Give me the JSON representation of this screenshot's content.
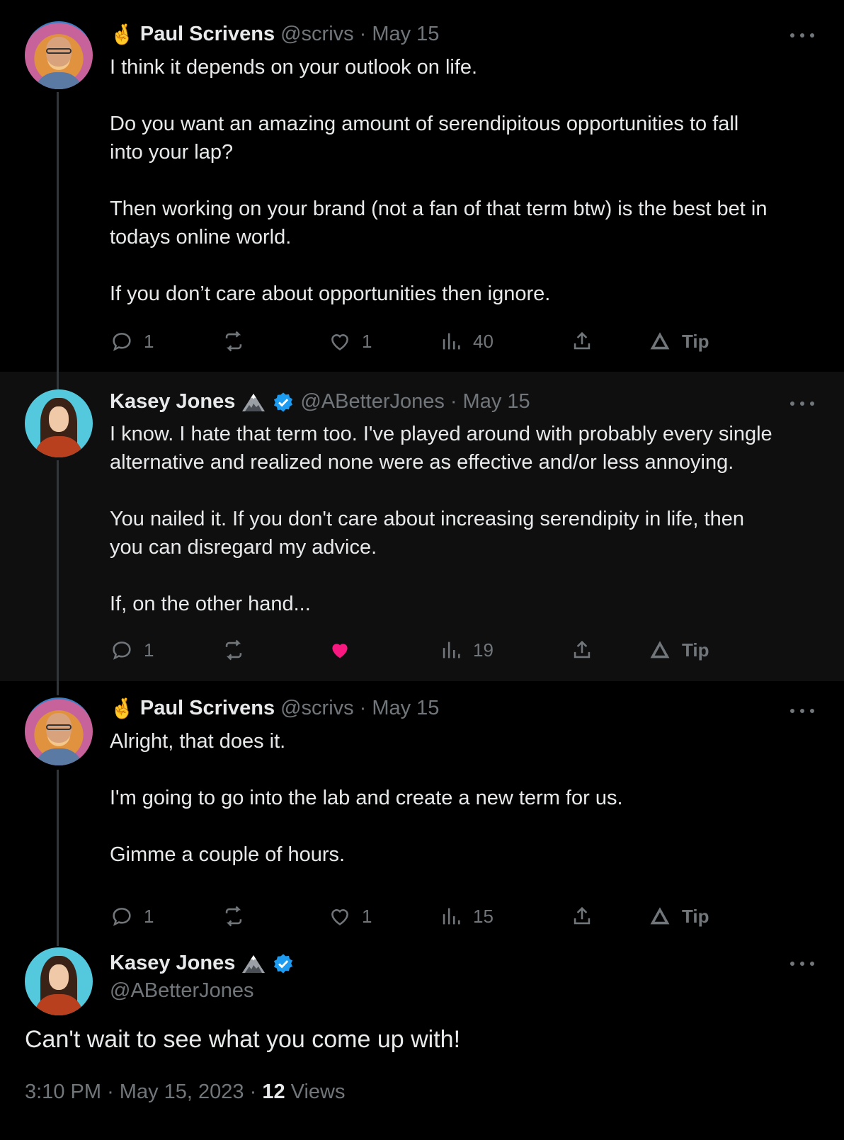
{
  "tweets": [
    {
      "author_emoji": "🤞",
      "author_name": "Paul Scrivens",
      "handle": "@scrivs",
      "separator": "·",
      "date": "May 15",
      "text": "I think it depends on your outlook on life.\n\nDo you want an amazing amount of serendipitous opportunities to fall\ninto your lap?\n\nThen working on your brand (not a fan of that term btw) is the best bet in\ntodays online world.\n\nIf you don’t care about opportunities then ignore.",
      "replies": "1",
      "likes": "1",
      "liked": false,
      "views": "40",
      "tip_label": "Tip"
    },
    {
      "author_name": "Kasey Jones",
      "handle": "@ABetterJones",
      "separator": "·",
      "date": "May 15",
      "text": "I know. I hate that term too. I've played around with probably every single\nalternative and realized none were as effective and/or less annoying.\n\nYou nailed it. If you don't care about increasing serendipity in life, then\nyou can disregard my advice.\n\nIf, on the other hand...",
      "replies": "1",
      "likes": "",
      "liked": true,
      "views": "19",
      "tip_label": "Tip"
    },
    {
      "author_emoji": "🤞",
      "author_name": "Paul Scrivens",
      "handle": "@scrivs",
      "separator": "·",
      "date": "May 15",
      "text": "Alright, that does it.\n\nI'm going to go into the lab and create a new term for us.\n\nGimme a couple of hours.",
      "replies": "1",
      "likes": "1",
      "liked": false,
      "views": "15",
      "tip_label": "Tip"
    }
  ],
  "focused": {
    "author_name": "Kasey Jones",
    "handle": "@ABetterJones",
    "text": "Can't wait to see what you come up with!",
    "time": "3:10 PM",
    "separator": "·",
    "date": "May 15, 2023",
    "views_count": "12",
    "views_label": "Views"
  },
  "colors": {
    "background": "#000000",
    "highlight_bg": "#0f0f10",
    "text": "#e7e9ea",
    "muted": "#71767b",
    "like_active": "#f91880",
    "verified": "#1d9bf0"
  }
}
